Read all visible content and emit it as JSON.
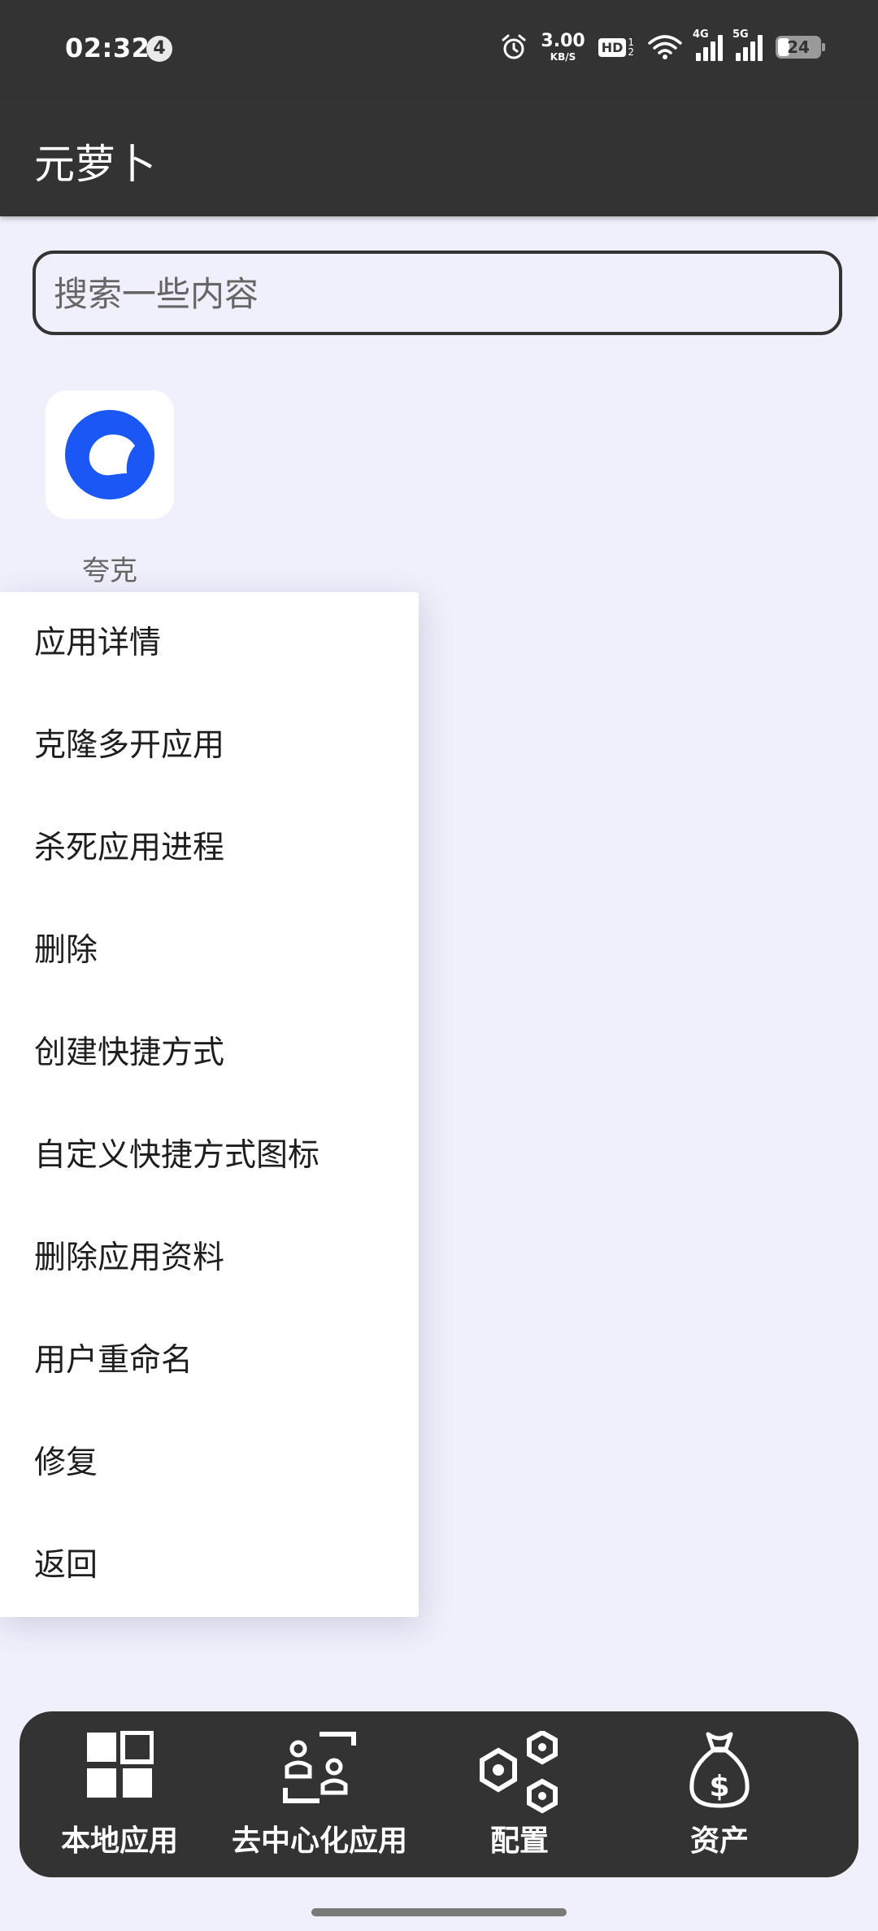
{
  "status_bar": {
    "time": "02:32",
    "notification_count": "4",
    "net_speed_value": "3.00",
    "net_speed_unit": "KB/S",
    "hd_label": "HD",
    "hd_sub_1": "1",
    "hd_sub_2": "2",
    "signal_1_label": "4G",
    "signal_2_label": "5G",
    "battery_level": "24"
  },
  "app_bar": {
    "title": "元萝卜"
  },
  "search": {
    "placeholder": "搜索一些内容",
    "value": ""
  },
  "apps": [
    {
      "name": "夸克",
      "icon": "quark-app-icon",
      "icon_color": "#1a57f5"
    }
  ],
  "context_menu": {
    "items": [
      "应用详情",
      "克隆多开应用",
      "杀死应用进程",
      "删除",
      "创建快捷方式",
      "自定义快捷方式图标",
      "删除应用资料",
      "用户重命名",
      "修复",
      "返回"
    ]
  },
  "bottom_nav": {
    "items": [
      {
        "label": "本地应用",
        "icon": "grid-icon"
      },
      {
        "label": "去中心化应用",
        "icon": "people-scan-icon"
      },
      {
        "label": "配置",
        "icon": "hexagon-nodes-icon"
      },
      {
        "label": "资产",
        "icon": "money-bag-icon"
      }
    ]
  },
  "colors": {
    "bar_background": "#333333",
    "page_background": "#eff0fb",
    "accent_blue": "#1a57f5"
  }
}
